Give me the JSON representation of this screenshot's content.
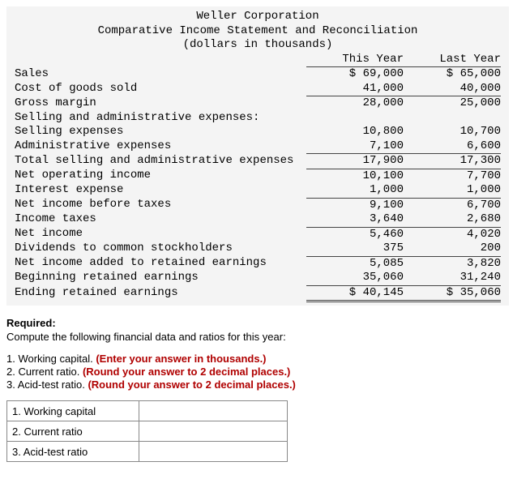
{
  "title_line1": "Weller Corporation",
  "title_line2": "Comparative Income Statement and Reconciliation",
  "title_line3": "(dollars in thousands)",
  "col_this": "This Year",
  "col_last": "Last Year",
  "rows": {
    "sales_lbl": "Sales",
    "sales_ty": "$ 69,000",
    "sales_ly": "$ 65,000",
    "cogs_lbl": "Cost of goods sold",
    "cogs_ty": "41,000",
    "cogs_ly": "40,000",
    "gm_lbl": "Gross margin",
    "gm_ty": "28,000",
    "gm_ly": "25,000",
    "sae_hdr": "Selling and administrative expenses:",
    "sell_lbl": "Selling expenses",
    "sell_ty": "10,800",
    "sell_ly": "10,700",
    "admin_lbl": "Administrative expenses",
    "admin_ty": "7,100",
    "admin_ly": "6,600",
    "tsae_lbl": "Total selling and administrative expenses",
    "tsae_ty": "17,900",
    "tsae_ly": "17,300",
    "noi_lbl": "Net operating income",
    "noi_ty": "10,100",
    "noi_ly": "7,700",
    "int_lbl": "Interest expense",
    "int_ty": "1,000",
    "int_ly": "1,000",
    "nibt_lbl": "Net income before taxes",
    "nibt_ty": "9,100",
    "nibt_ly": "6,700",
    "tax_lbl": "Income taxes",
    "tax_ty": "3,640",
    "tax_ly": "2,680",
    "ni_lbl": "Net income",
    "ni_ty": "5,460",
    "ni_ly": "4,020",
    "div_lbl": "Dividends to common stockholders",
    "div_ty": "375",
    "div_ly": "200",
    "niare_lbl": "Net income added to retained earnings",
    "niare_ty": "5,085",
    "niare_ly": "3,820",
    "bre_lbl": "Beginning retained earnings",
    "bre_ty": "35,060",
    "bre_ly": "31,240",
    "ere_lbl": "Ending retained earnings",
    "ere_ty": "$ 40,145",
    "ere_ly": "$ 35,060"
  },
  "required_heading": "Required:",
  "required_instruction": "Compute the following financial data and ratios for this year:",
  "q1_main": "1. Working capital. ",
  "q1_hint": "(Enter your answer in thousands.)",
  "q2_main": "2. Current ratio. ",
  "q2_hint": "(Round your answer to 2 decimal places.)",
  "q3_main": "3. Acid-test ratio. ",
  "q3_hint": "(Round your answer to 2 decimal places.)",
  "answer_labels": {
    "r1": "1. Working capital",
    "r2": "2. Current ratio",
    "r3": "3. Acid-test ratio"
  }
}
